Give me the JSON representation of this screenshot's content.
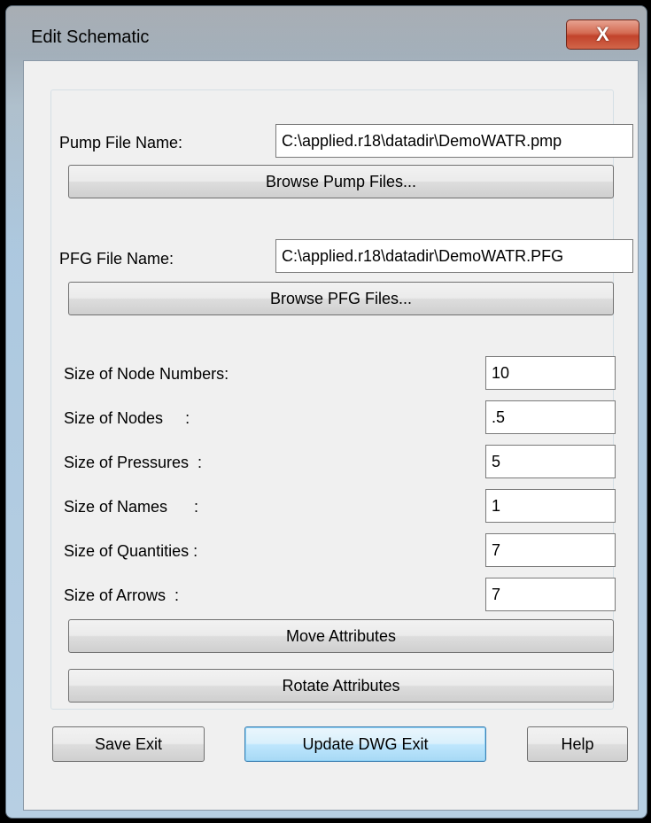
{
  "window": {
    "title": "Edit Schematic",
    "close_symbol": "X"
  },
  "pump": {
    "label": "Pump File Name:",
    "value": "C:\\applied.r18\\datadir\\DemoWATR.pmp",
    "browse_label": "Browse Pump Files..."
  },
  "pfg": {
    "label": "PFG File Name:",
    "value": "C:\\applied.r18\\datadir\\DemoWATR.PFG",
    "browse_label": "Browse PFG Files..."
  },
  "sizes": {
    "node_numbers": {
      "label": "Size of Node Numbers:",
      "value": "10"
    },
    "nodes": {
      "label": "Size of Nodes     :",
      "value": ".5"
    },
    "pressures": {
      "label": "Size of Pressures  :",
      "value": "5"
    },
    "names": {
      "label": "Size of Names      :",
      "value": "1"
    },
    "quantities": {
      "label": "Size of Quantities :",
      "value": "7"
    },
    "arrows": {
      "label": "Size of Arrows  :",
      "value": "7"
    }
  },
  "actions": {
    "move_attributes": "Move Attributes",
    "rotate_attributes": "Rotate Attributes"
  },
  "footer": {
    "save_exit": "Save  Exit",
    "update_dwg_exit": "Update DWG  Exit",
    "help": "Help"
  }
}
